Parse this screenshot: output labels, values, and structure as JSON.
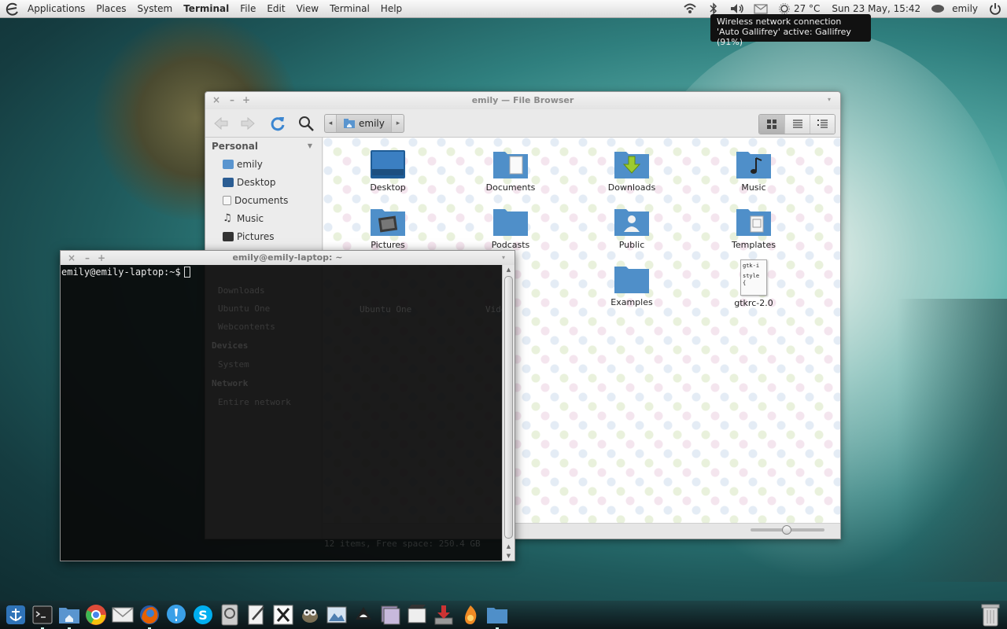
{
  "panel": {
    "menu": [
      "Applications",
      "Places",
      "System"
    ],
    "active_app": "Terminal",
    "app_menu": [
      "File",
      "Edit",
      "View",
      "Terminal",
      "Help"
    ],
    "weather": "27 °C",
    "datetime": "Sun 23 May, 15:42",
    "user": "emily"
  },
  "tooltip": "Wireless network connection 'Auto Gallifrey' active: Gallifrey (91%)",
  "file_browser": {
    "title": "emily — File Browser",
    "breadcrumb": "emily",
    "sidebar": {
      "section_personal": "Personal",
      "items": [
        "emily",
        "Desktop",
        "Documents",
        "Music",
        "Pictures"
      ],
      "hidden_items": [
        "Downloads",
        "Ubuntu One",
        "Webcontents"
      ],
      "section_devices": "Devices",
      "devices": [
        "System"
      ],
      "section_network": "Network",
      "network": [
        "Entire network"
      ]
    },
    "files": [
      "Desktop",
      "Documents",
      "Downloads",
      "Music",
      "Pictures",
      "Podcasts",
      "Public",
      "Templates",
      "Ubuntu One",
      "Videos",
      "Examples",
      "gtkrc-2.0"
    ],
    "gtkrc_preview": [
      "gtk-i",
      "style",
      "{"
    ],
    "status": "12 items, Free space: 250.4 GB"
  },
  "terminal": {
    "title": "emily@emily-laptop: ~",
    "prompt": "emily@emily-laptop:~$"
  },
  "dock": [
    "anchor",
    "terminal",
    "home-folder",
    "chromium",
    "mail",
    "firefox",
    "notifications",
    "skype",
    "disk-utility",
    "text-editor",
    "xchat",
    "gimp",
    "image-viewer",
    "inkscape",
    "photo-manager",
    "video-editor",
    "downloader",
    "burner",
    "files"
  ],
  "colors": {
    "panel_bg": "#e6e6e6",
    "folder_blue": "#4f8fc9",
    "terminal_bg": "#0b0b0b"
  }
}
